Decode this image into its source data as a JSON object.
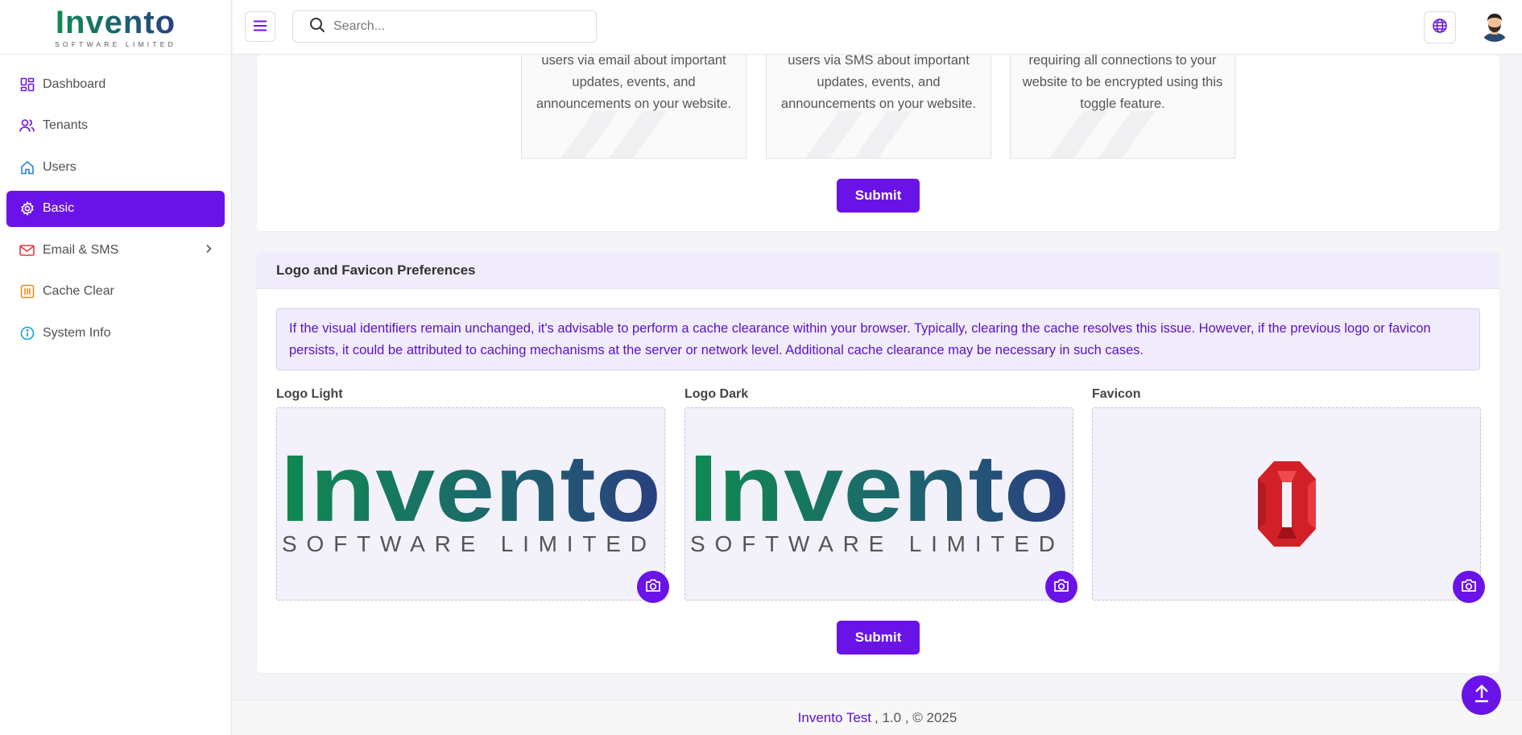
{
  "brand": {
    "name": "Invento",
    "subtitle": "SOFTWARE LIMITED"
  },
  "sidebar": {
    "items": [
      {
        "label": "Dashboard",
        "icon": "dashboard-icon"
      },
      {
        "label": "Tenants",
        "icon": "users-icon"
      },
      {
        "label": "Users",
        "icon": "home-icon"
      },
      {
        "label": "Basic",
        "icon": "gear-icon",
        "active": true
      },
      {
        "label": "Email & SMS",
        "icon": "mail-icon"
      },
      {
        "label": "Cache Clear",
        "icon": "cache-icon"
      },
      {
        "label": "System Info",
        "icon": "info-icon"
      }
    ]
  },
  "topbar": {
    "search_placeholder": "Search..."
  },
  "features": [
    {
      "text": "users via email about important updates, events, and announcements on your website."
    },
    {
      "text": "users via SMS about important updates, events, and announcements on your website."
    },
    {
      "text": "requiring all connections to your website to be encrypted using this toggle feature."
    }
  ],
  "settings_submit_label": "Submit",
  "logo_section": {
    "title": "Logo and Favicon Preferences",
    "notice": "If the visual identifiers remain unchanged, it's advisable to perform a cache clearance within your browser. Typically, clearing the cache resolves this issue. However, if the previous logo or favicon persists, it could be attributed to caching mechanisms at the server or network level. Additional cache clearance may be necessary in such cases.",
    "uploads": [
      {
        "label": "Logo Light"
      },
      {
        "label": "Logo Dark"
      },
      {
        "label": "Favicon"
      }
    ],
    "submit_label": "Submit"
  },
  "footer": {
    "app_name": "Invento Test",
    "rest": ", 1.0 , © 2025"
  },
  "colors": {
    "accent": "#6a13e8",
    "brand_green": "#0f8a4f",
    "brand_navy": "#2a3f80",
    "favicon_red": "#d32027"
  }
}
